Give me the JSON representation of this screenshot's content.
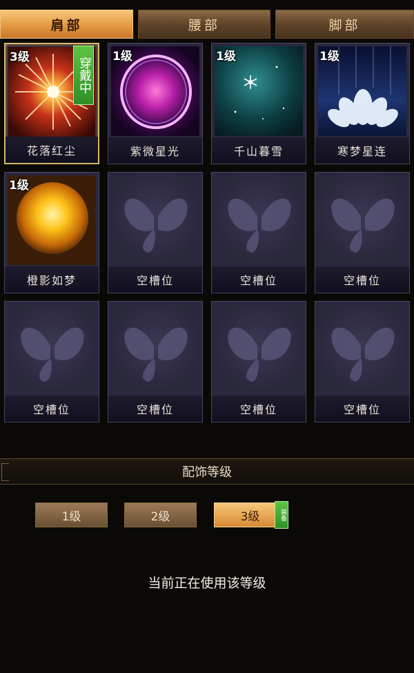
{
  "tabs": [
    {
      "label": "肩部",
      "active": true
    },
    {
      "label": "腰部",
      "active": false
    },
    {
      "label": "脚部",
      "active": false
    }
  ],
  "slots": [
    {
      "level": "3级",
      "name": "花落红尘",
      "equipped_label": "穿戴中",
      "icon": "red-sunburst-icon"
    },
    {
      "level": "1级",
      "name": "紫微星光",
      "icon": "purple-orb-icon"
    },
    {
      "level": "1级",
      "name": "千山暮雪",
      "icon": "snowflake-star-icon"
    },
    {
      "level": "1级",
      "name": "寒梦星连",
      "icon": "lotus-icon"
    },
    {
      "level": "1级",
      "name": "橙影如梦",
      "icon": "sun-orb-icon"
    },
    {
      "name": "空槽位",
      "icon": "butterfly-icon"
    },
    {
      "name": "空槽位",
      "icon": "butterfly-icon"
    },
    {
      "name": "空槽位",
      "icon": "butterfly-icon"
    },
    {
      "name": "空槽位",
      "icon": "butterfly-icon"
    },
    {
      "name": "空槽位",
      "icon": "butterfly-icon"
    },
    {
      "name": "空槽位",
      "icon": "butterfly-icon"
    },
    {
      "name": "空槽位",
      "icon": "butterfly-icon"
    }
  ],
  "section": {
    "title": "配饰等级"
  },
  "levels": [
    {
      "label": "1级",
      "active": false
    },
    {
      "label": "2级",
      "active": false
    },
    {
      "label": "3级",
      "active": true,
      "badge": "装备"
    }
  ],
  "status": "当前正在使用该等级",
  "colors": {
    "active_tab": "#e49a42",
    "equipped_badge": "#3fa52e",
    "empty_slot": "#2a2840",
    "background": "#0b0906"
  }
}
